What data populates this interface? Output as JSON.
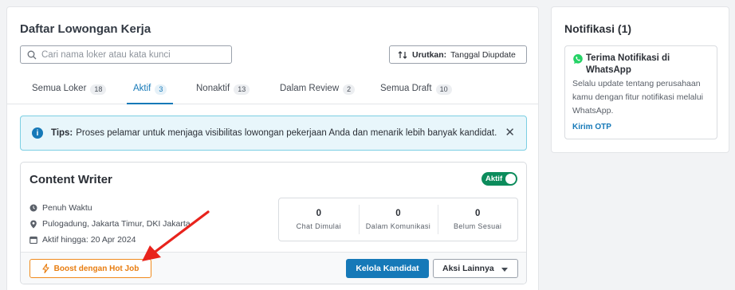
{
  "page": {
    "title": "Daftar Lowongan Kerja"
  },
  "search": {
    "placeholder": "Cari nama loker atau kata kunci",
    "icon": "search-icon"
  },
  "sort": {
    "label": "Urutkan:",
    "value": "Tanggal Diupdate",
    "icon": "sort-icon"
  },
  "tabs": [
    {
      "label": "Semua Loker",
      "count": "18",
      "active": false
    },
    {
      "label": "Aktif",
      "count": "3",
      "active": true
    },
    {
      "label": "Nonaktif",
      "count": "13",
      "active": false
    },
    {
      "label": "Dalam Review",
      "count": "2",
      "active": false
    },
    {
      "label": "Semua Draft",
      "count": "10",
      "active": false
    }
  ],
  "tip": {
    "label": "Tips:",
    "text": "Proses pelamar untuk menjaga visibilitas lowongan pekerjaan Anda dan menarik lebih banyak kandidat.",
    "close": "✕"
  },
  "job": {
    "title": "Content Writer",
    "status_label": "Aktif",
    "status_on": true,
    "employment_type": "Penuh Waktu",
    "location": "Pulogadung, Jakarta Timur, DKI Jakarta",
    "active_until_label": "Aktif hingga:",
    "active_until_date": "20 Apr 2024",
    "stats": [
      {
        "value": "0",
        "label": "Chat Dimulai"
      },
      {
        "value": "0",
        "label": "Dalam Komunikasi"
      },
      {
        "value": "0",
        "label": "Belum Sesuai"
      }
    ],
    "boost_label": "Boost dengan Hot Job",
    "manage_label": "Kelola Kandidat",
    "more_label": "Aksi Lainnya"
  },
  "sidebar": {
    "title": "Notifikasi (1)",
    "notification": {
      "title": "Terima Notifikasi di WhatsApp",
      "body": "Selalu update tentang perusahaan kamu dengan fitur notifikasi melalui WhatsApp.",
      "link": "Kirim OTP"
    }
  },
  "colors": {
    "primary": "#1679b8",
    "active_green": "#0c8c5c",
    "boost_orange": "#f08a1c",
    "annotation_red": "#e8231c",
    "tip_bg": "#e8f6fb"
  }
}
